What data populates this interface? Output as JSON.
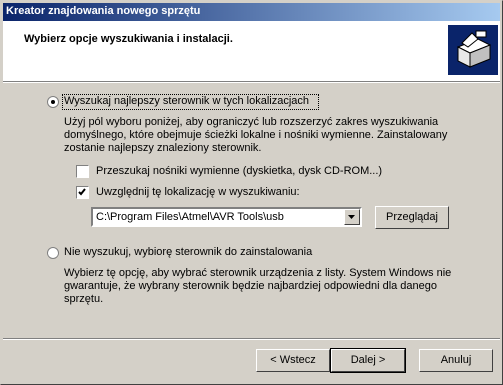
{
  "window": {
    "title": "Kreator znajdowania nowego sprzętu"
  },
  "header": {
    "title": "Wybierz opcje wyszukiwania i instalacji.",
    "icon": "wizard-box-icon"
  },
  "option_search": {
    "label": "Wyszukaj najlepszy sterownik w tych lokalizacjach",
    "selected": true,
    "description": "Użyj pól wyboru poniżej, aby ograniczyć lub rozszerzyć zakres wyszukiwania domyślnego, które obejmuje ścieżki lokalne i nośniki wymienne. Zainstalowany zostanie najlepszy znaleziony sterownik.",
    "removable_media": {
      "label": "Przeszukaj nośniki wymienne (dyskietka, dysk CD-ROM...)",
      "checked": false
    },
    "include_location": {
      "label": "Uwzględnij tę lokalizację w wyszukiwaniu:",
      "checked": true
    },
    "path_value": "C:\\Program Files\\Atmel\\AVR Tools\\usb",
    "browse_label": "Przeglądaj"
  },
  "option_manual": {
    "label": "Nie wyszukuj, wybiorę sterownik do zainstalowania",
    "selected": false,
    "description": "Wybierz tę opcję, aby wybrać sterownik urządzenia z listy. System Windows nie gwarantuje, że wybrany sterownik będzie najbardziej odpowiedni dla danego sprzętu."
  },
  "buttons": {
    "back": "< Wstecz",
    "next": "Dalej >",
    "cancel": "Anuluj"
  }
}
